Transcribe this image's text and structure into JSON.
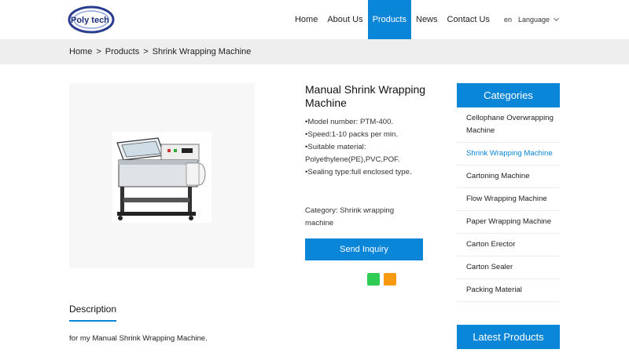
{
  "header": {
    "logo_text": "Poly tech",
    "nav": [
      "Home",
      "About Us",
      "Products",
      "News",
      "Contact Us"
    ],
    "active_nav": "Products",
    "lang_code": "en",
    "lang_label": "Language"
  },
  "breadcrumb": {
    "home": "Home",
    "sep1": ">",
    "products": "Products",
    "sep2": ">",
    "current": "Shrink Wrapping Machine"
  },
  "product": {
    "title": "Manual Shrink Wrapping Machine",
    "specs": [
      "•Model number: PTM-400.",
      "•Speed:1-10 packs per min.",
      "•Suitable material: Polyethylene(PE),PVC,POF.",
      "•Sealing type:full enclosed type."
    ],
    "category": "Category: Shrink wrapping machine",
    "inquiry_label": "Send Inquiry"
  },
  "description": {
    "tab_label": "Description",
    "text": "for my Manual Shrink Wrapping Machine."
  },
  "sidebar": {
    "categories_title": "Categories",
    "items": [
      "Cellophane Overwrapping Machine",
      "Shrink Wrapping Machine",
      "Cartoning Machine",
      "Flow Wrapping Machine",
      "Paper Wrapping Machine",
      "Carton Erector",
      "Carton Sealer",
      "Packing Material"
    ],
    "active_item": "Shrink Wrapping Machine",
    "latest_title": "Latest Products"
  },
  "colors": {
    "accent": "#0a86d8",
    "share_green": "#2ecc55",
    "share_orange": "#f79a10"
  }
}
